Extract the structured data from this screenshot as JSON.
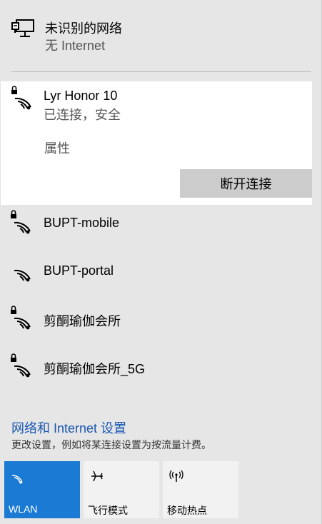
{
  "ethernet": {
    "title": "未识别的网络",
    "status": "无 Internet"
  },
  "active_network": {
    "name": "Lyr Honor 10",
    "status": "已连接，安全",
    "properties_label": "属性",
    "disconnect_label": "断开连接",
    "secured": true
  },
  "networks": [
    {
      "name": "BUPT-mobile",
      "secured": true
    },
    {
      "name": "BUPT-portal",
      "secured": false
    },
    {
      "name": "剪酮瑜伽会所",
      "secured": true
    },
    {
      "name": "剪酮瑜伽会所_5G",
      "secured": true
    }
  ],
  "settings": {
    "link_label": "网络和 Internet 设置",
    "description": "更改设置，例如将某连接设置为按流量计费。"
  },
  "quick_actions": [
    {
      "label": "WLAN",
      "icon": "wifi-icon",
      "active": true
    },
    {
      "label": "飞行模式",
      "icon": "airplane-icon",
      "active": false
    },
    {
      "label": "移动热点",
      "icon": "hotspot-icon",
      "active": false
    }
  ],
  "colors": {
    "accent": "#1a7ad4",
    "link": "#1a57b3",
    "panel_bg": "#e6e6e6"
  }
}
